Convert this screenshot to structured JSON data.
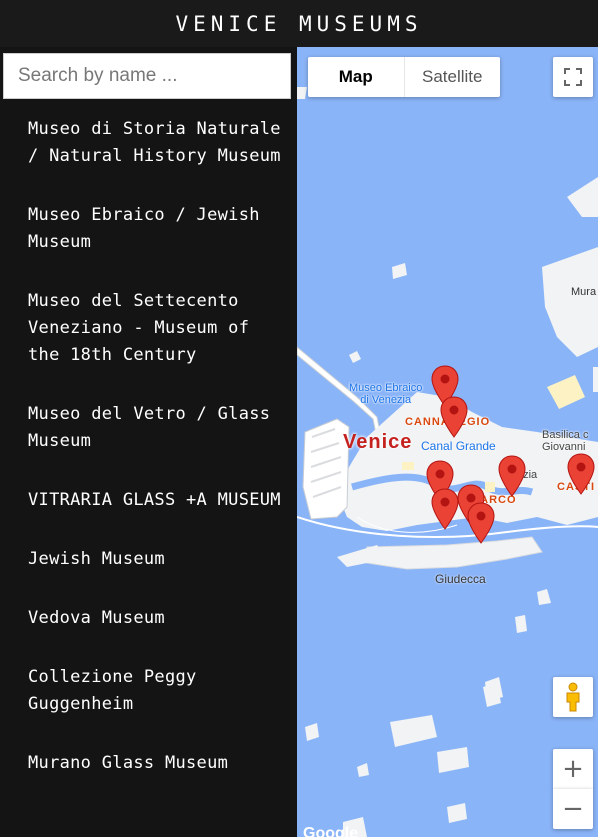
{
  "header": {
    "title": "VENICE MUSEUMS"
  },
  "search": {
    "placeholder": "Search by name ..."
  },
  "museums": [
    {
      "name": "Museo di Storia Naturale / Natural History Museum"
    },
    {
      "name": "Museo Ebraico / Jewish Museum"
    },
    {
      "name": "Museo del Settecento Veneziano - Museum of the 18th Century"
    },
    {
      "name": "Museo del Vetro / Glass Museum"
    },
    {
      "name": "VITRARIA GLASS +A MUSEUM"
    },
    {
      "name": "Jewish Museum"
    },
    {
      "name": "Vedova Museum"
    },
    {
      "name": "Collezione Peggy Guggenheim"
    },
    {
      "name": "Murano Glass Museum"
    }
  ],
  "map": {
    "type_map": "Map",
    "type_satellite": "Satellite",
    "zoom_in": "+",
    "zoom_out": "−",
    "labels": {
      "venice": "Venice",
      "cannaregio": "CANNAREGIO",
      "san_marco": "MARCO",
      "castello": "CASTI",
      "museo_ebraico": "Museo Ebraico\ndi Venezia",
      "canal_grande": "Canal Grande",
      "basilica": "Basilica c\nGiovanni",
      "ezia": "ezia",
      "giudecca": "Giudecca",
      "mura": "Mura",
      "google": "Google"
    }
  },
  "colors": {
    "water": "#8ab4f8",
    "land": "#f1f3f4",
    "marker": "#ea4335",
    "sidebar": "#141414"
  }
}
